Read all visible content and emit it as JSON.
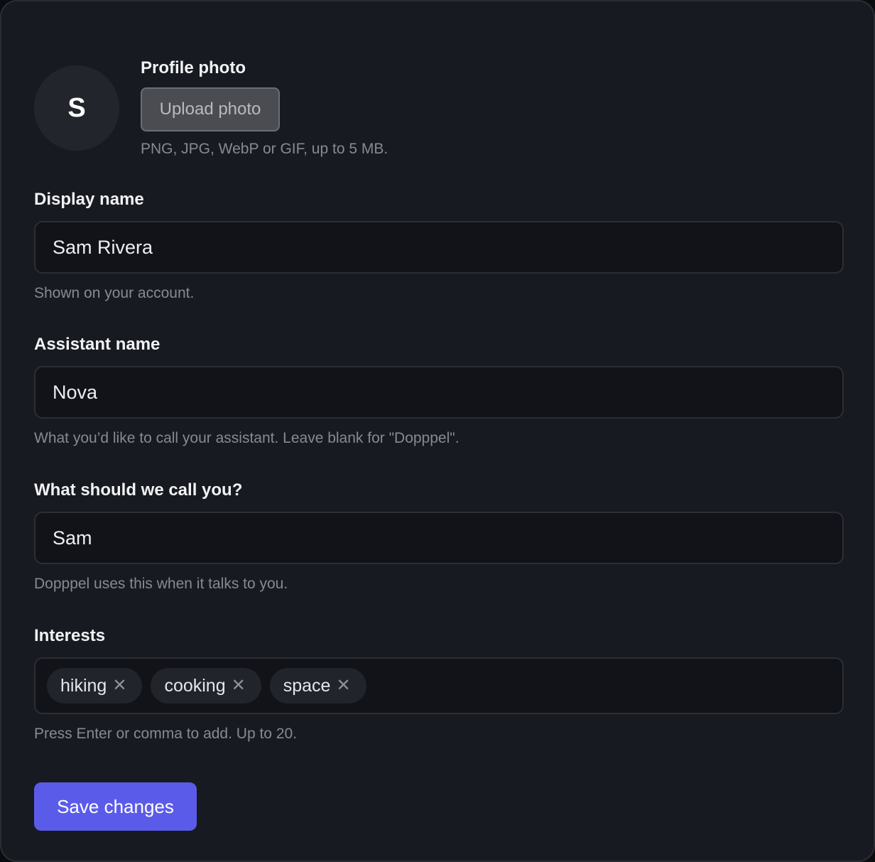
{
  "profile_photo": {
    "avatar_initial": "S",
    "label": "Profile photo",
    "upload_label": "Upload photo",
    "hint": "PNG, JPG, WebP or GIF, up to 5 MB."
  },
  "display_name": {
    "label": "Display name",
    "value": "Sam Rivera",
    "hint": "Shown on your account."
  },
  "assistant_name": {
    "label": "Assistant name",
    "value": "Nova",
    "hint": "What you’d like to call your assistant. Leave blank for \"Dopppel\"."
  },
  "call_you": {
    "label": "What should we call you?",
    "value": "Sam",
    "hint": "Dopppel uses this when it talks to you."
  },
  "interests": {
    "label": "Interests",
    "tags": [
      "hiking",
      "cooking",
      "space"
    ],
    "remove_glyph": "✕",
    "hint": "Press Enter or comma to add. Up to 20."
  },
  "save_label": "Save changes",
  "colors": {
    "accent": "#5b5bea",
    "card_bg": "#181a21",
    "input_bg": "#121318"
  }
}
